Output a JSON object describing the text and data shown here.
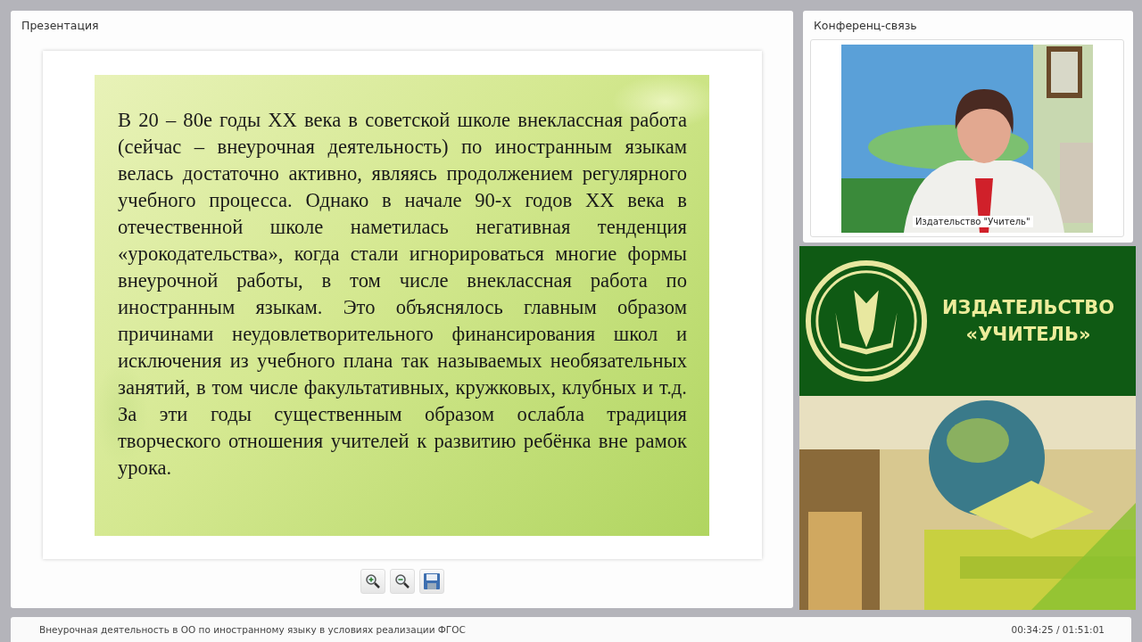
{
  "presentation": {
    "title": "Презентация",
    "slide": {
      "text": "В 20 – 80е годы XX века в советской школе внеклассная работа (сейчас – внеурочная деятельность) по иностранным языкам велась достаточно активно, являясь продолжением регулярного учебного процесса. Однако в начале 90-х годов XX века в отечественной школе наметилась негативная тенденция «урокодательства», когда стали игнорироваться многие формы внеурочной работы, в том числе внеклассная работа по иностранным языкам. Это объяснялось главным образом причинами неудовлетворительного финансирования школ и исключения из учебного плана так называемых необязательных занятий, в том числе факультативных, кружковых, клубных и т.д. За эти годы существенным образом ослабла традиция творческого отношения учителей к развитию ребёнка вне рамок урока."
    },
    "toolbar": [
      {
        "kind": "zoom-in"
      },
      {
        "kind": "zoom-out"
      },
      {
        "kind": "save"
      }
    ]
  },
  "conference": {
    "title": "Конференц-связь",
    "video": {
      "kind": "picture",
      "caption": "Издательство \"Учитель\""
    }
  },
  "banner": {
    "lines": [
      "ИЗДАТЕЛЬСТВО",
      "«УЧИТЕЛЬ»"
    ]
  },
  "status_bar": {
    "title": "Внеурочная деятельность в ОО по иностранному языку в условиях реализации ФГОС",
    "time": "00:34:25 / 01:51:01"
  }
}
